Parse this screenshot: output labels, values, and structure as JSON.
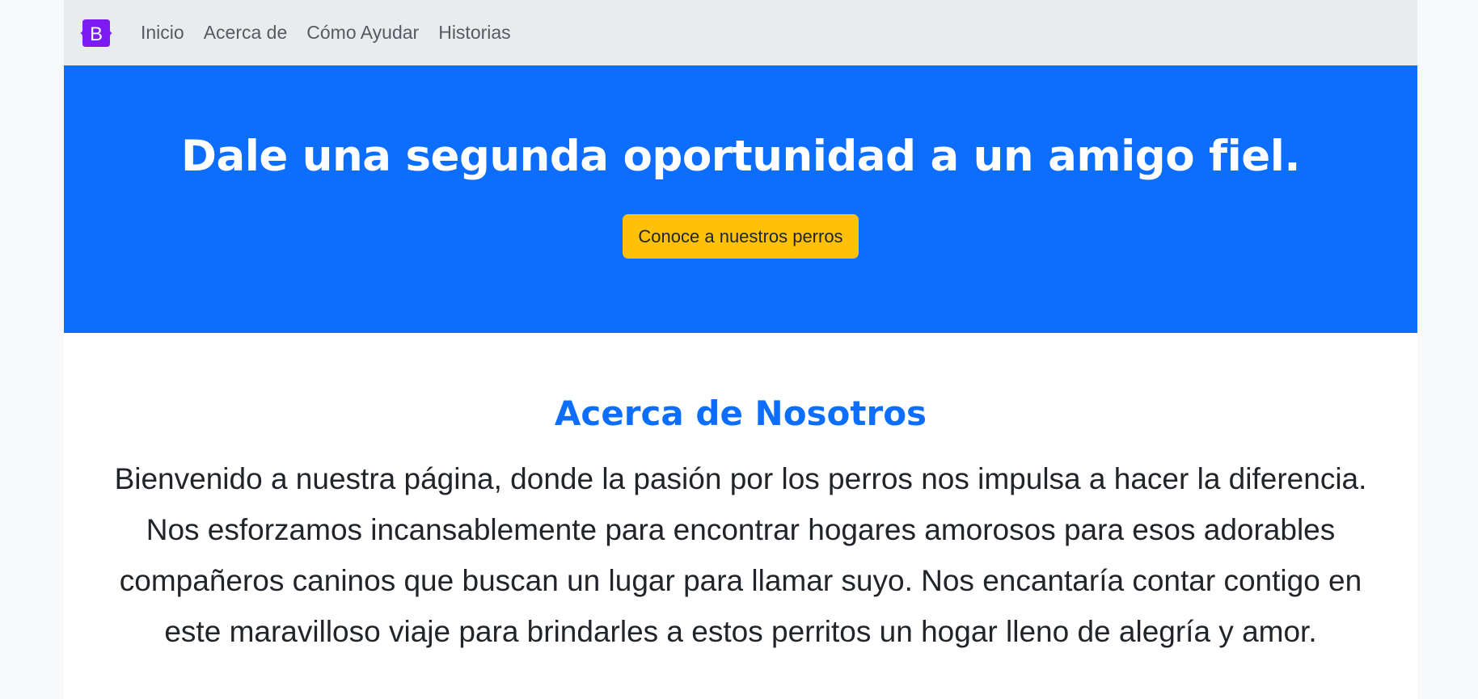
{
  "navbar": {
    "brand_letter": "B",
    "brand_color": "#7c1cf2",
    "items": [
      {
        "label": "Inicio"
      },
      {
        "label": "Acerca de"
      },
      {
        "label": "Cómo Ayudar"
      },
      {
        "label": "Historias"
      }
    ]
  },
  "hero": {
    "title": "Dale una segunda oportunidad a un amigo fiel.",
    "cta_label": "Conoce a nuestros perros",
    "background": "#0d6efd",
    "cta_color": "#ffc107"
  },
  "about": {
    "heading": "Acerca de Nosotros",
    "text": "Bienvenido a nuestra página, donde la pasión por los perros nos impulsa a hacer la diferencia. Nos esforzamos incansablemente para encontrar hogares amorosos para esos adorables compañeros caninos que buscan un lugar para llamar suyo. Nos encantaría contar contigo en este maravilloso viaje para brindarles a estos perritos un hogar lleno de alegría y amor."
  }
}
